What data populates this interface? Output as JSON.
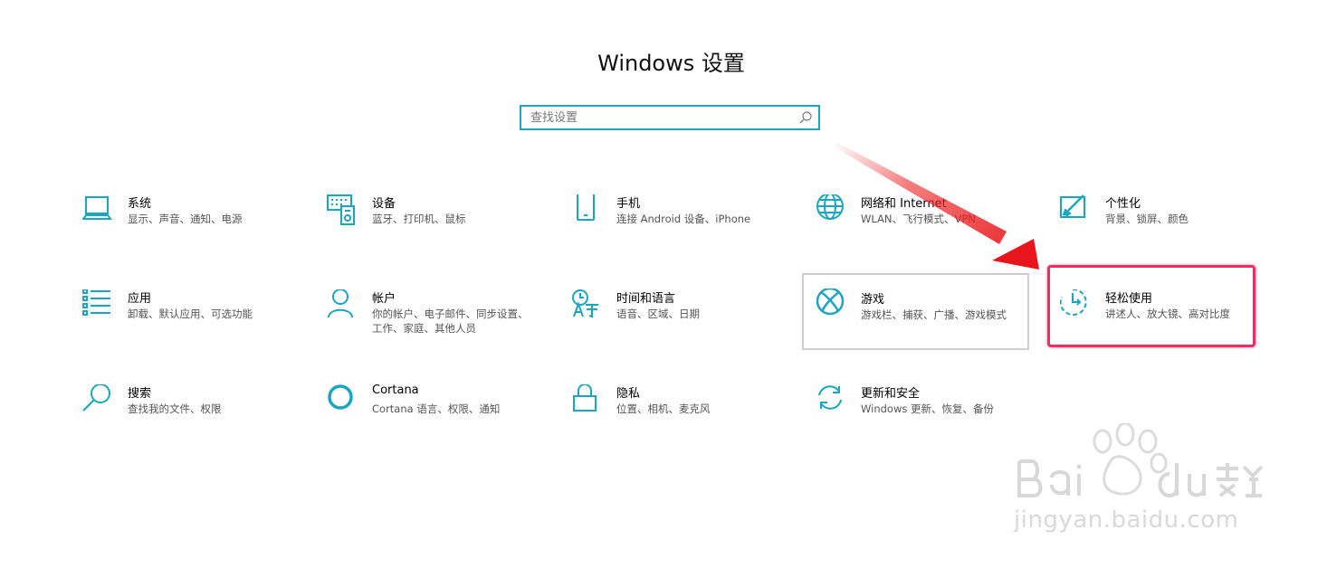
{
  "window": {
    "title": "Windows 设置"
  },
  "search": {
    "placeholder": "查找设置",
    "value": ""
  },
  "accent_color": "#19a7bf",
  "highlight_color": "#ee2e60",
  "tiles": [
    {
      "icon": "laptop-icon",
      "name": "系统",
      "desc": "显示、声音、通知、电源"
    },
    {
      "icon": "keyboard-printer-icon",
      "name": "设备",
      "desc": "蓝牙、打印机、鼠标"
    },
    {
      "icon": "phone-icon",
      "name": "手机",
      "desc": "连接 Android 设备、iPhone"
    },
    {
      "icon": "globe-icon",
      "name": "网络和 Internet",
      "desc": "WLAN、飞行模式、VPN"
    },
    {
      "icon": "paintbrush-icon",
      "name": "个性化",
      "desc": "背景、锁屏、颜色"
    },
    {
      "icon": "apps-list-icon",
      "name": "应用",
      "desc": "卸载、默认应用、可选功能"
    },
    {
      "icon": "person-icon",
      "name": "帐户",
      "desc": "你的帐户、电子邮件、同步设置、工作、家庭、其他人员"
    },
    {
      "icon": "time-language-icon",
      "name": "时间和语言",
      "desc": "语音、区域、日期"
    },
    {
      "icon": "xbox-icon",
      "name": "游戏",
      "desc": "游戏栏、捕获、广播、游戏模式"
    },
    {
      "icon": "ease-of-access-icon",
      "name": "轻松使用",
      "desc": "讲述人、放大镜、高对比度"
    },
    {
      "icon": "search-icon",
      "name": "搜索",
      "desc": "查找我的文件、权限"
    },
    {
      "icon": "cortana-icon",
      "name": "Cortana",
      "desc": "Cortana 语言、权限、通知"
    },
    {
      "icon": "lock-icon",
      "name": "隐私",
      "desc": "位置、相机、麦克风"
    },
    {
      "icon": "update-icon",
      "name": "更新和安全",
      "desc": "Windows 更新、恢复、备份"
    }
  ],
  "watermark": {
    "logo": "Baidu经验",
    "url": "jingyan.baidu.com"
  }
}
